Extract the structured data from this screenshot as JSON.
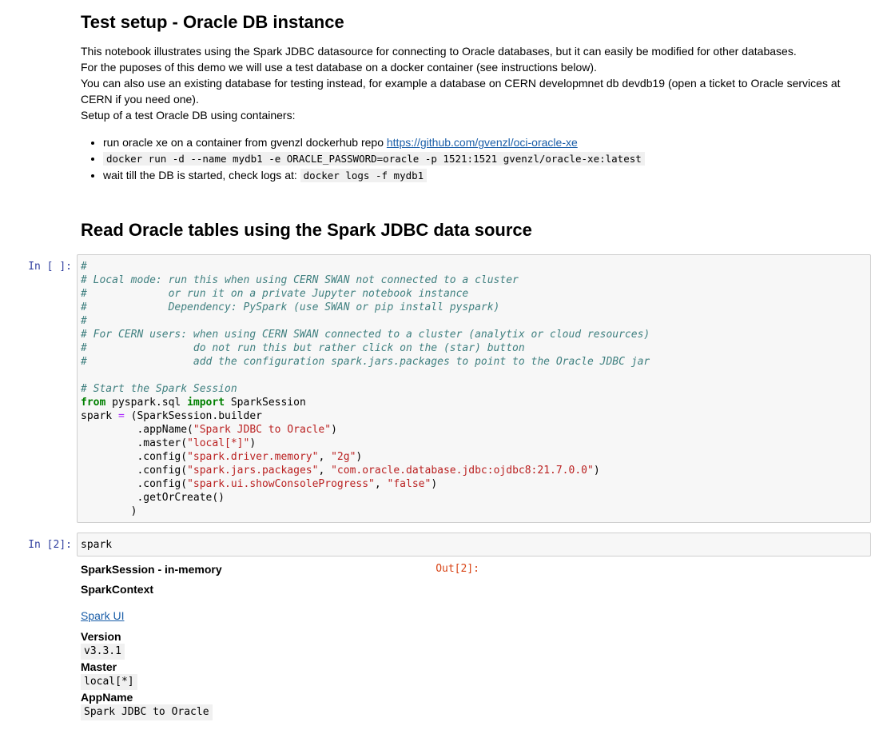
{
  "markdown": {
    "heading1": "Test setup - Oracle DB instance",
    "para1": "This notebook illustrates using the Spark JDBC datasource for connecting to Oracle databases, but it can easily be modified for other databases.",
    "para2": "For the puposes of this demo we will use a test database on a docker container (see instructions below).",
    "para3": "You can also use an existing database for testing instead, for example a database on CERN developmnet db devdb19 (open a ticket to Oracle services at CERN if you need one).",
    "para4": "Setup of a test Oracle DB using containers:",
    "bullet1_text": "run oracle xe on a container from gvenzl dockerhub repo ",
    "bullet1_link": "https://github.com/gvenzl/oci-oracle-xe",
    "bullet2_code": "docker run -d --name mydb1 -e ORACLE_PASSWORD=oracle -p 1521:1521 gvenzl/oracle-xe:latest",
    "bullet3_text": "wait till the DB is started, check logs at: ",
    "bullet3_code": "docker logs -f mydb1",
    "heading2": "Read Oracle tables using the Spark JDBC data source"
  },
  "cells": {
    "cell1_prompt": "In [ ]:",
    "cell2_prompt": "In [2]:",
    "cell2_code": "spark",
    "out2_prompt": "Out[2]:"
  },
  "code1": {
    "c1": "#",
    "c2": "# Local mode: run this when using CERN SWAN not connected to a cluster",
    "c3": "#             or run it on a private Jupyter notebook instance",
    "c4": "#             Dependency: PySpark (use SWAN or pip install pyspark)",
    "c5": "#",
    "c6": "# For CERN users: when using CERN SWAN connected to a cluster (analytix or cloud resources)",
    "c7": "#                 do not run this but rather click on the (star) button",
    "c8": "#                 add the configuration spark.jars.packages to point to the Oracle JDBC jar",
    "c9": "# Start the Spark Session",
    "from_kw": "from",
    "module": " pyspark.sql ",
    "import_kw": "import",
    "cls": " SparkSession",
    "spark_lhs": "spark ",
    "eq": "=",
    "builder": " (SparkSession.builder",
    "appname_pre": "         .appName(",
    "appname_str": "\"Spark JDBC to Oracle\"",
    "close_paren": ")",
    "master_pre": "         .master(",
    "master_str": "\"local[*]\"",
    "cfg_pre": "         .config(",
    "cfg1_key": "\"spark.driver.memory\"",
    "comma": ", ",
    "cfg1_val": "\"2g\"",
    "cfg2_key": "\"spark.jars.packages\"",
    "cfg2_val": "\"com.oracle.database.jdbc:ojdbc8:21.7.0.0\"",
    "cfg3_key": "\"spark.ui.showConsoleProgress\"",
    "cfg3_val": "\"false\"",
    "getorcreate": "         .getOrCreate()",
    "final_paren": "        )"
  },
  "output": {
    "session_title": "SparkSession - in-memory",
    "context_title": "SparkContext",
    "spark_ui_link": "Spark UI",
    "version_label": "Version",
    "version_value": "v3.3.1",
    "master_label": "Master",
    "master_value": "local[*]",
    "appname_label": "AppName",
    "appname_value": "Spark JDBC to Oracle"
  }
}
